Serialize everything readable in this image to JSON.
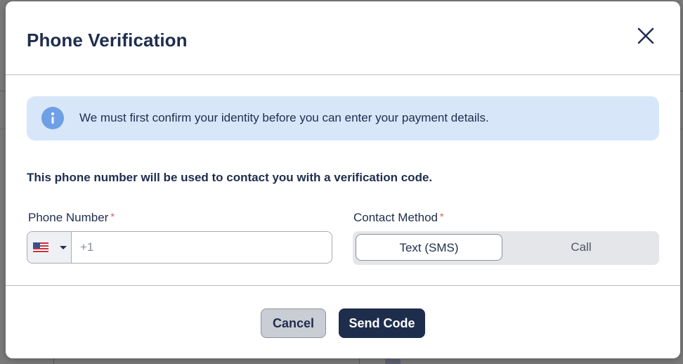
{
  "dialog": {
    "title": "Phone Verification",
    "close_icon": "close-icon"
  },
  "info_banner": {
    "icon": "info-icon",
    "text": "We must first confirm your identity before you can enter your payment details."
  },
  "instructions": "This phone number will be used to contact you with a verification code.",
  "phone_field": {
    "label": "Phone Number",
    "required_marker": "*",
    "country_flag": "us-flag-icon",
    "placeholder": "+1",
    "value": ""
  },
  "contact_method": {
    "label": "Contact Method",
    "required_marker": "*",
    "options": [
      "Text (SMS)",
      "Call"
    ],
    "selected": "Text (SMS)"
  },
  "footer": {
    "cancel_label": "Cancel",
    "send_label": "Send Code"
  },
  "colors": {
    "primary": "#1f2d4d",
    "info_background": "#d8e6fa",
    "info_icon": "#6f9fe5",
    "required": "#e05252"
  }
}
